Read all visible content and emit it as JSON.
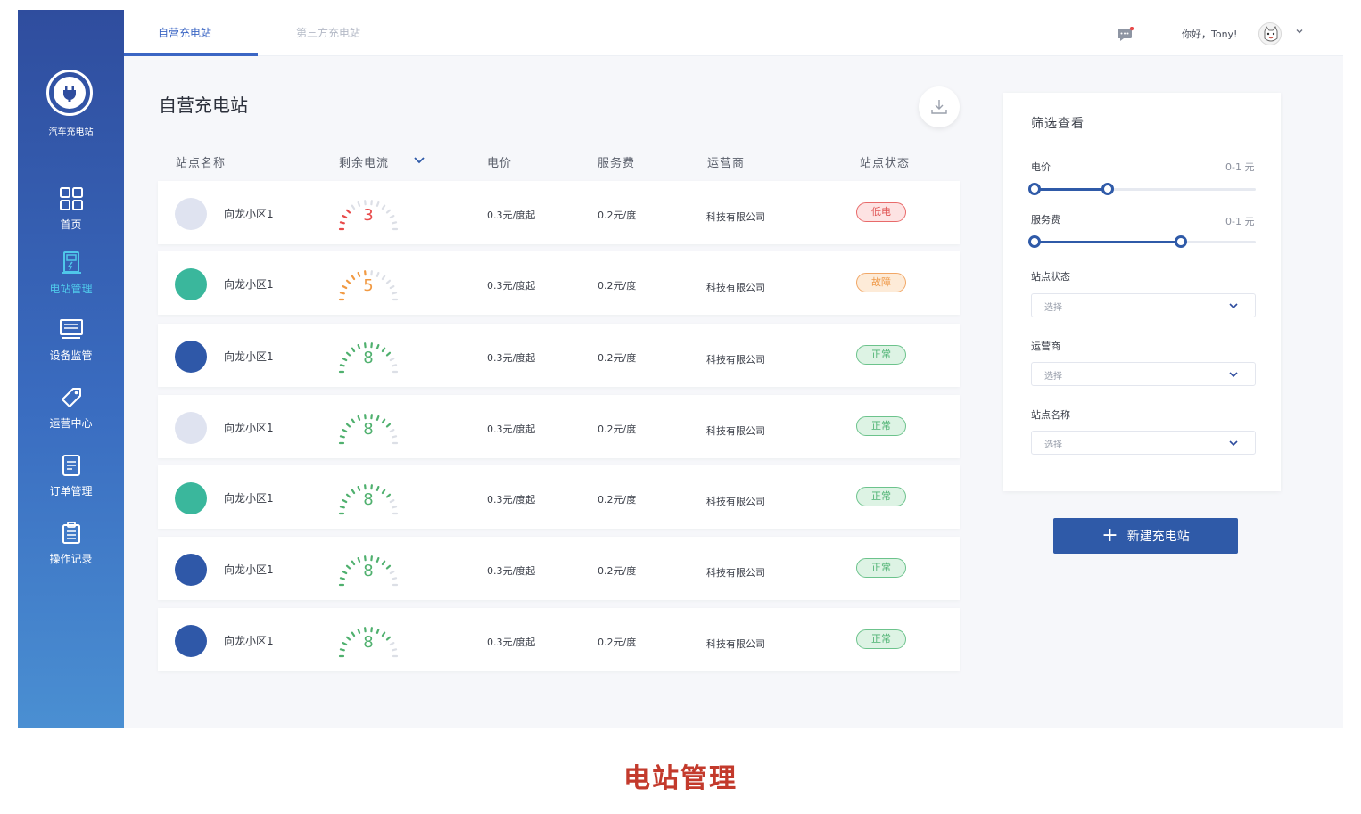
{
  "sidebar": {
    "logo_text": "汽车充电站",
    "items": [
      {
        "label": "首页",
        "icon": "grid-icon"
      },
      {
        "label": "电站管理",
        "icon": "charger-icon",
        "active": true
      },
      {
        "label": "设备监管",
        "icon": "monitor-icon"
      },
      {
        "label": "运营中心",
        "icon": "tag-icon"
      },
      {
        "label": "订单管理",
        "icon": "document-icon"
      },
      {
        "label": "操作记录",
        "icon": "clipboard-icon"
      }
    ]
  },
  "header": {
    "tabs": [
      {
        "label": "自营充电站",
        "active": true
      },
      {
        "label": "第三方充电站",
        "active": false
      }
    ],
    "greeting": "你好，Tony!"
  },
  "main": {
    "title": "自营充电站",
    "columns": [
      "站点名称",
      "剩余电流",
      "电价",
      "服务费",
      "运营商",
      "站点状态"
    ],
    "rows": [
      {
        "name": "向龙小区1",
        "current": "3",
        "price": "0.3元/度起",
        "fee": "0.2元/度",
        "operator": "科技有限公司",
        "status": "低电",
        "status_type": "low",
        "dot_color": "#dfe3f0",
        "gauge_color": "#e84a4a",
        "gauge_level": 0.3
      },
      {
        "name": "向龙小区1",
        "current": "5",
        "price": "0.3元/度起",
        "fee": "0.2元/度",
        "operator": "科技有限公司",
        "status": "故障",
        "status_type": "fault",
        "dot_color": "#3ab79c",
        "gauge_color": "#f19a43",
        "gauge_level": 0.5
      },
      {
        "name": "向龙小区1",
        "current": "8",
        "price": "0.3元/度起",
        "fee": "0.2元/度",
        "operator": "科技有限公司",
        "status": "正常",
        "status_type": "ok",
        "dot_color": "#2f58a8",
        "gauge_color": "#4fb06e",
        "gauge_level": 0.8
      },
      {
        "name": "向龙小区1",
        "current": "8",
        "price": "0.3元/度起",
        "fee": "0.2元/度",
        "operator": "科技有限公司",
        "status": "正常",
        "status_type": "ok",
        "dot_color": "#dfe3f0",
        "gauge_color": "#4fb06e",
        "gauge_level": 0.8
      },
      {
        "name": "向龙小区1",
        "current": "8",
        "price": "0.3元/度起",
        "fee": "0.2元/度",
        "operator": "科技有限公司",
        "status": "正常",
        "status_type": "ok",
        "dot_color": "#3ab79c",
        "gauge_color": "#4fb06e",
        "gauge_level": 0.8
      },
      {
        "name": "向龙小区1",
        "current": "8",
        "price": "0.3元/度起",
        "fee": "0.2元/度",
        "operator": "科技有限公司",
        "status": "正常",
        "status_type": "ok",
        "dot_color": "#2f58a8",
        "gauge_color": "#4fb06e",
        "gauge_level": 0.8
      },
      {
        "name": "向龙小区1",
        "current": "8",
        "price": "0.3元/度起",
        "fee": "0.2元/度",
        "operator": "科技有限公司",
        "status": "正常",
        "status_type": "ok",
        "dot_color": "#2f58a8",
        "gauge_color": "#4fb06e",
        "gauge_level": 0.8
      }
    ]
  },
  "filter": {
    "title": "筛选查看",
    "price_label": "电价",
    "price_range": "0-1 元",
    "price_slider": {
      "low": 0.0,
      "high": 0.33
    },
    "fee_label": "服务费",
    "fee_range": "0-1 元",
    "fee_slider": {
      "low": 0.0,
      "high": 0.66
    },
    "status_label": "站点状态",
    "operator_label": "运营商",
    "station_label": "站点名称",
    "select_placeholder": "选择",
    "new_button": "新建充电站"
  },
  "caption": "电站管理",
  "colors": {
    "accent": "#2f5aa8",
    "sidebar_top": "#2f4d9e",
    "sidebar_bottom": "#4a8fd2",
    "active_nav": "#4fc7ea",
    "caption": "#c33a2c"
  }
}
